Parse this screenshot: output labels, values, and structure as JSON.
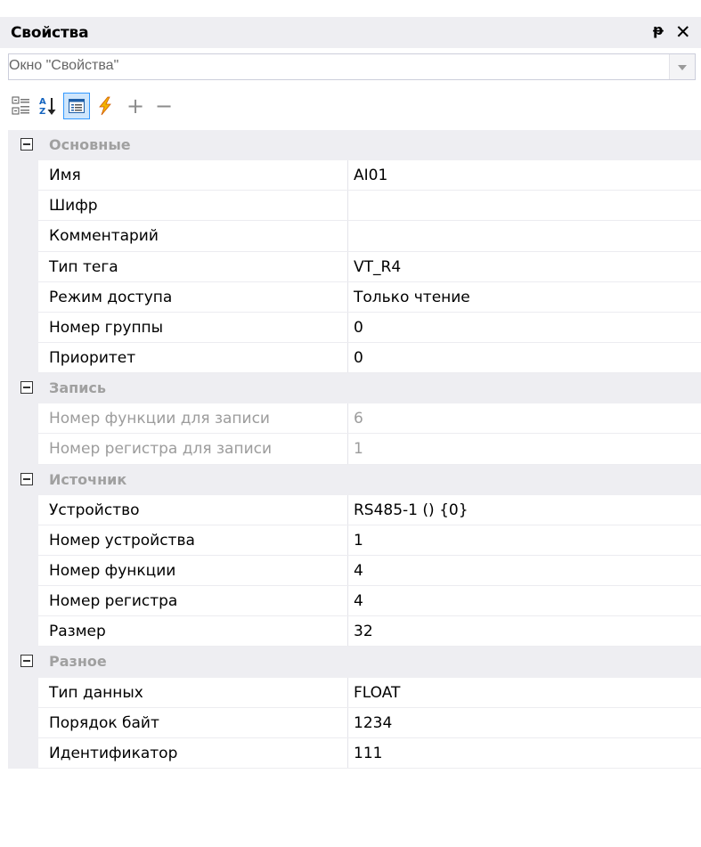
{
  "window": {
    "title": "Свойства",
    "pin_glyph": "ᵽ",
    "close_glyph": "✕"
  },
  "object_selector": {
    "value": "Окно \"Свойства\""
  },
  "toolbar": {
    "plus_glyph": "+",
    "minus_glyph": "−",
    "icons": [
      "categorized-icon",
      "alphabetical-icon",
      "properties-icon",
      "events-icon",
      "add-icon",
      "remove-icon"
    ]
  },
  "colors": {
    "accent": "#3399ff",
    "category_bg": "#eeeef2",
    "disabled_text": "#9c9c9c"
  },
  "properties": {
    "categories": [
      {
        "name": "Основные",
        "items": [
          {
            "name": "Имя",
            "value": "AI01"
          },
          {
            "name": "Шифр",
            "value": ""
          },
          {
            "name": "Комментарий",
            "value": ""
          },
          {
            "name": "Тип тега",
            "value": "VT_R4"
          },
          {
            "name": "Режим доступа",
            "value": "Только чтение"
          },
          {
            "name": "Номер группы",
            "value": "0"
          },
          {
            "name": "Приоритет",
            "value": "0"
          }
        ]
      },
      {
        "name": "Запись",
        "items": [
          {
            "name": "Номер функции для записи",
            "value": "6",
            "disabled": true
          },
          {
            "name": "Номер регистра для записи",
            "value": "1",
            "disabled": true
          }
        ]
      },
      {
        "name": "Источник",
        "items": [
          {
            "name": "Устройство",
            "value": "RS485-1 () {0}"
          },
          {
            "name": "Номер устройства",
            "value": "1"
          },
          {
            "name": "Номер функции",
            "value": "4"
          },
          {
            "name": "Номер регистра",
            "value": "4"
          },
          {
            "name": "Размер",
            "value": "32"
          }
        ]
      },
      {
        "name": "Разное",
        "items": [
          {
            "name": "Тип данных",
            "value": "FLOAT"
          },
          {
            "name": "Порядок байт",
            "value": "1234"
          },
          {
            "name": "Идентификатор",
            "value": "111"
          }
        ]
      }
    ]
  }
}
